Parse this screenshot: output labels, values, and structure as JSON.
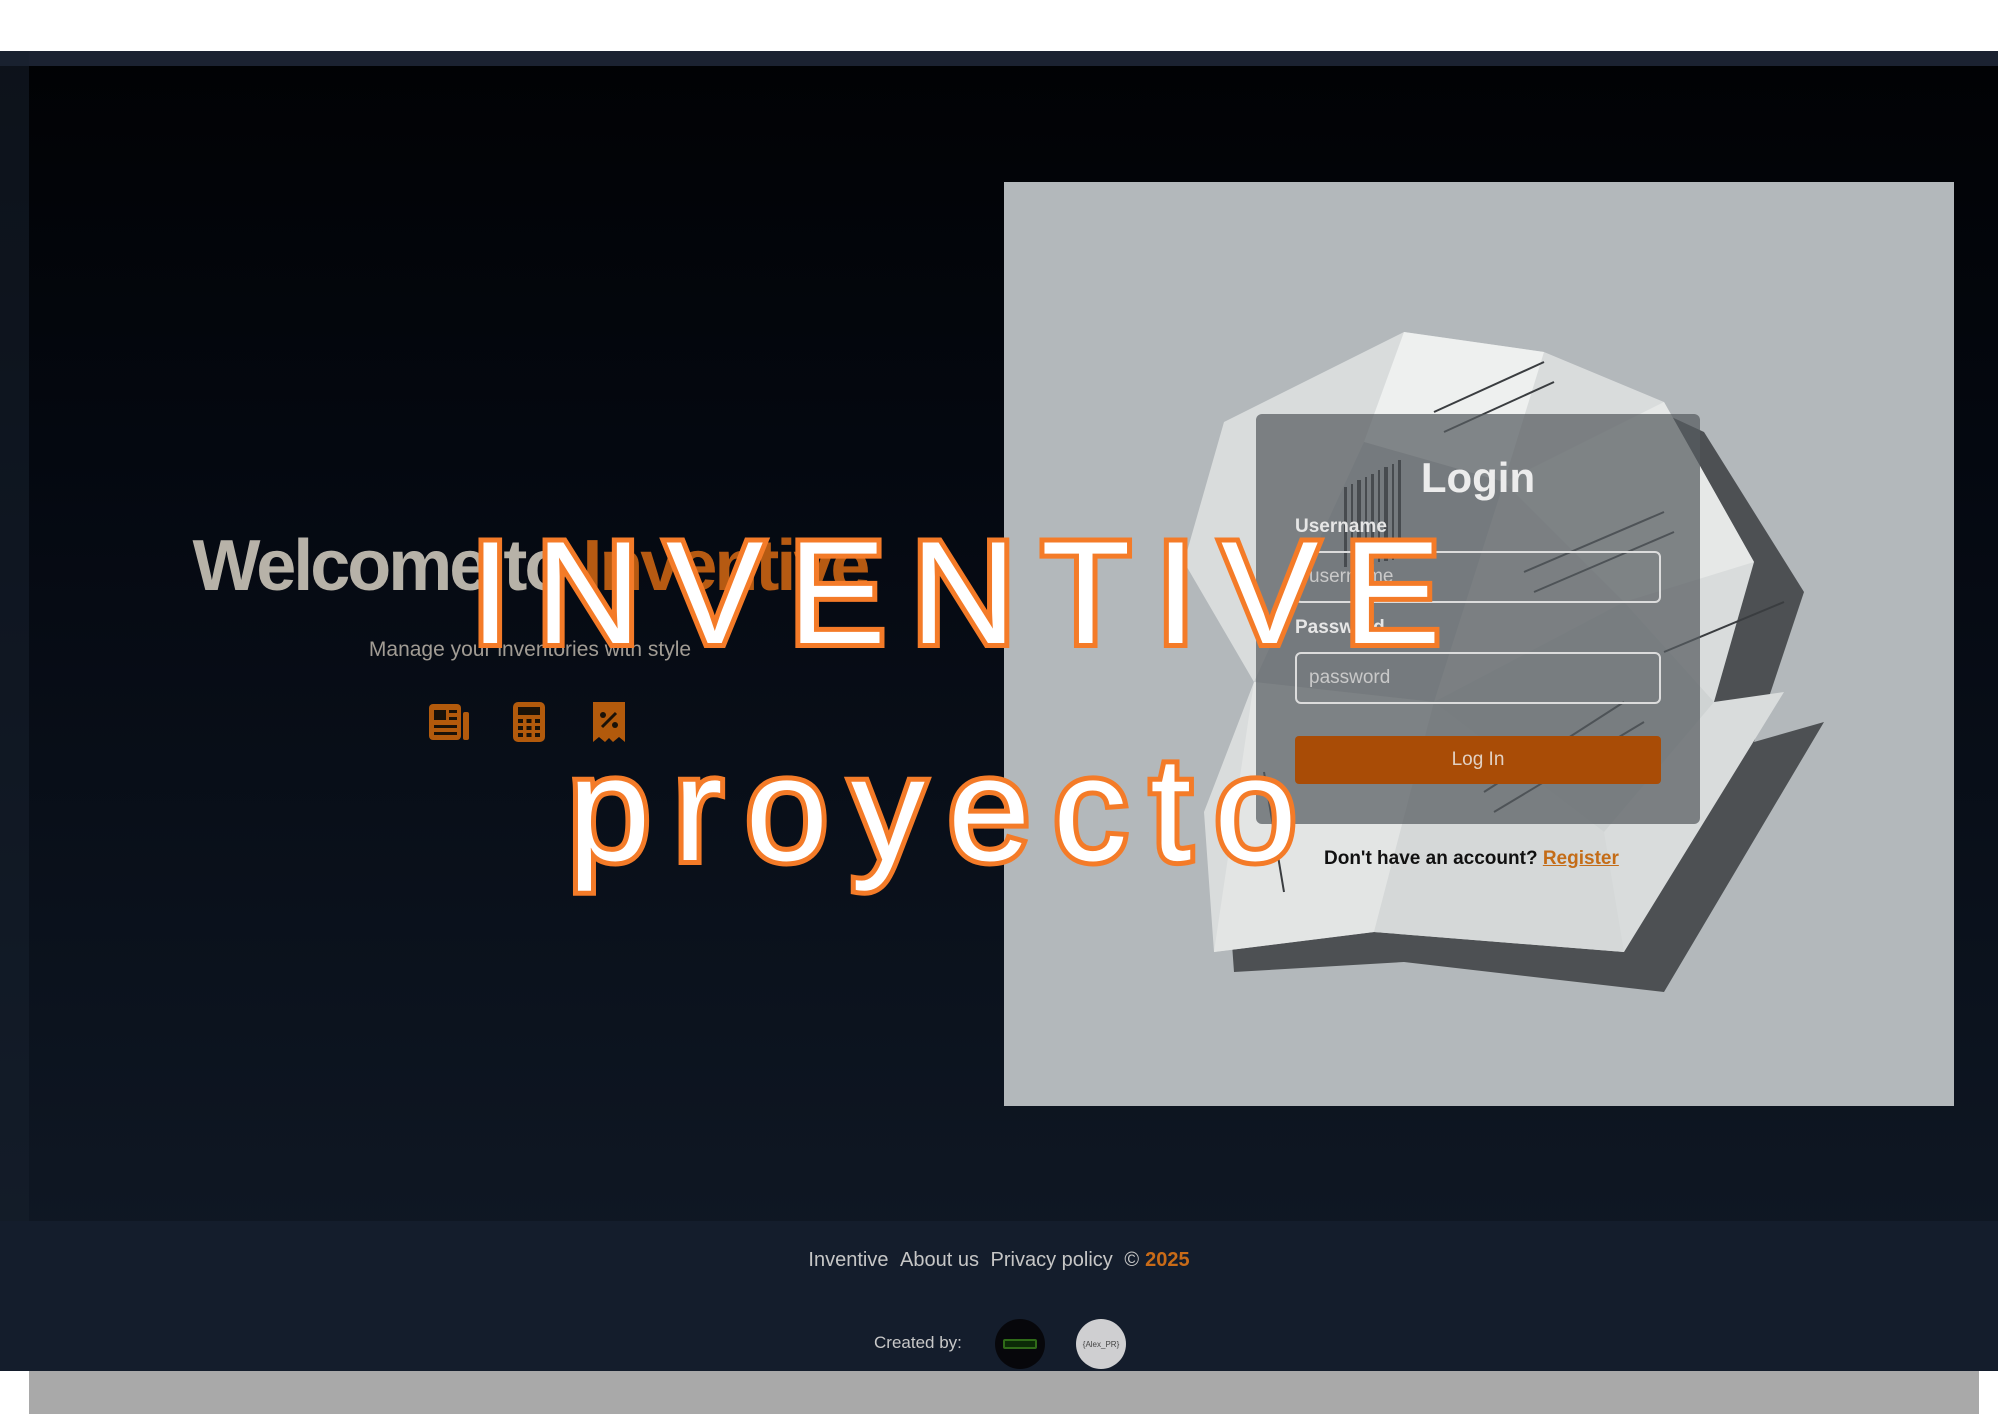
{
  "hero": {
    "title_prefix": "Welcome to ",
    "title_brand": "Inventive",
    "subtitle": "Manage your inventories with style",
    "icons": [
      "newspaper-icon",
      "calculator-icon",
      "receipt-percent-icon"
    ]
  },
  "login": {
    "title": "Login",
    "username_label": "Username",
    "username_placeholder": "username",
    "password_label": "Password",
    "password_placeholder": "password",
    "button_label": "Log In",
    "register_prompt": "Don't have an account?",
    "register_link": "Register"
  },
  "overlay": {
    "line1": "INVENTIVE",
    "line2": "proyecto"
  },
  "footer": {
    "links": [
      "Inventive",
      "About us",
      "Privacy policy"
    ],
    "copyright_symbol": "©",
    "year": "2025",
    "created_by_label": "Created by:",
    "creator_avatar_2_text": "{Alex_PR}"
  },
  "colors": {
    "accent": "#b65a12",
    "overlay_stroke": "#f47b28",
    "button": "#a94c06",
    "footer_bg": "#141d2c"
  }
}
